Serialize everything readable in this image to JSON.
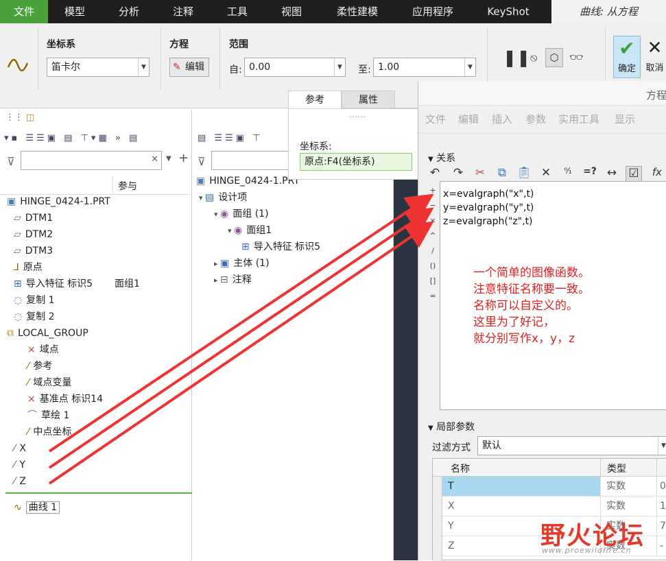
{
  "menubar": {
    "items": [
      "文件",
      "模型",
      "分析",
      "注释",
      "工具",
      "视图",
      "柔性建模",
      "应用程序",
      "KeyShot"
    ],
    "active_tab": "曲线: 从方程"
  },
  "ribbon": {
    "coord_group_label": "坐标系",
    "coord_value": "笛卡尔",
    "equation_group_label": "方程",
    "edit_button": "编辑",
    "range_group_label": "范围",
    "from_label": "自:",
    "from_value": "0.00",
    "to_label": "至:",
    "to_value": "1.00",
    "confirm_label": "确定",
    "cancel_label": "取消",
    "tab_reference": "参考",
    "tab_properties": "属性"
  },
  "coord_popup": {
    "label": "坐标系:",
    "value": "原点:F4(坐标系)"
  },
  "left_panel": {
    "col_header": "参与",
    "tree": [
      {
        "label": "HINGE_0424-1.PRT",
        "ref": ""
      },
      {
        "label": "DTM1",
        "ref": ""
      },
      {
        "label": "DTM2",
        "ref": ""
      },
      {
        "label": "DTM3",
        "ref": ""
      },
      {
        "label": "原点",
        "ref": ""
      },
      {
        "label": "导入特征 标识5",
        "ref": "面组1"
      },
      {
        "label": "复制 1",
        "ref": ""
      },
      {
        "label": "复制 2",
        "ref": ""
      },
      {
        "label": "LOCAL_GROUP",
        "ref": ""
      },
      {
        "label": "域点",
        "ref": ""
      },
      {
        "label": "参考",
        "ref": ""
      },
      {
        "label": "域点变量",
        "ref": ""
      },
      {
        "label": "基准点 标识14",
        "ref": ""
      },
      {
        "label": "草绘 1",
        "ref": ""
      },
      {
        "label": "中点坐标",
        "ref": ""
      },
      {
        "label": "X",
        "ref": ""
      },
      {
        "label": "Y",
        "ref": ""
      },
      {
        "label": "Z",
        "ref": ""
      },
      {
        "label": "曲线 1",
        "ref": ""
      }
    ]
  },
  "mid_panel": {
    "tree": [
      {
        "label": "HINGE_0424-1.PRT"
      },
      {
        "label": "设计项"
      },
      {
        "label": "面组 (1)"
      },
      {
        "label": "面组1"
      },
      {
        "label": "导入特征 标识5"
      },
      {
        "label": "主体 (1)"
      },
      {
        "label": "注释"
      }
    ]
  },
  "equation_window": {
    "title": "方程",
    "menu": [
      "文件",
      "编辑",
      "插入",
      "参数",
      "实用工具",
      "显示"
    ],
    "relations_label": "关系",
    "lines": [
      "x=evalgraph(\"x\",t)",
      "y=evalgraph(\"y\",t)",
      "z=evalgraph(\"z\",t)"
    ],
    "note_lines": [
      "一个简单的图像函数。",
      "注意特征名称要一致。",
      "名称可以自定义的。",
      "这里为了好记，",
      "就分别写作x，y，z"
    ],
    "local_params_label": "局部参数",
    "filter_label": "过滤方式",
    "filter_value": "默认",
    "table_headers": [
      "名称",
      "类型"
    ],
    "table_rows": [
      {
        "name": "T",
        "type": "实数",
        "value": "0"
      },
      {
        "name": "X",
        "type": "实数",
        "value": "1"
      },
      {
        "name": "Y",
        "type": "实数",
        "value": "7"
      },
      {
        "name": "Z",
        "type": "实数",
        "value": "-"
      }
    ]
  },
  "watermark": {
    "text": "野火论坛",
    "url": "www.proewildfire.cn"
  },
  "colors": {
    "accent_green": "#4aa33a",
    "arrow_red": "#ee3333",
    "note_red": "#e02020",
    "selected_row": "#a8d8f0"
  }
}
